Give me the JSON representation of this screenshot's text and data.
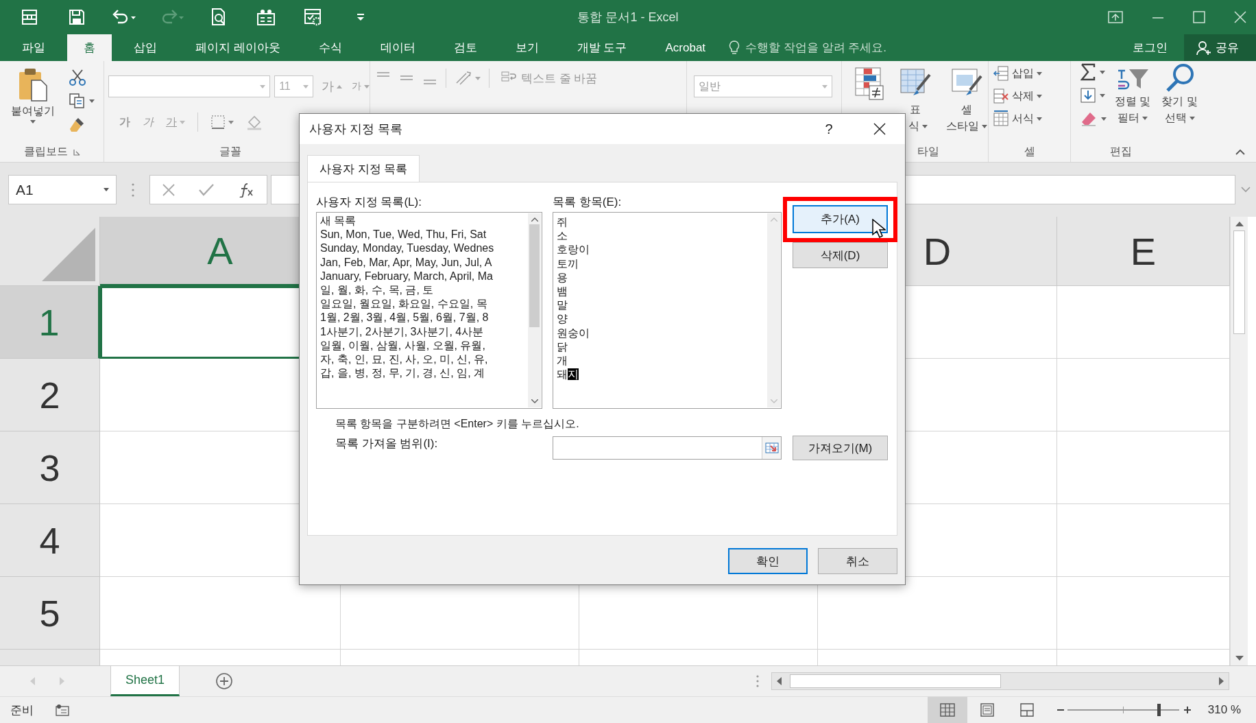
{
  "window": {
    "title": "통합 문서1 - Excel"
  },
  "quick_access": [
    {
      "kind": "form",
      "disabled": false
    },
    {
      "kind": "save",
      "disabled": false
    },
    {
      "kind": "undo",
      "disabled": false
    },
    {
      "kind": "redo",
      "disabled": true
    },
    {
      "kind": "preview",
      "disabled": false
    },
    {
      "kind": "board",
      "disabled": false
    },
    {
      "kind": "macro",
      "disabled": false
    },
    {
      "kind": "customize",
      "disabled": false
    }
  ],
  "ribbon_tabs": [
    {
      "label": "파일",
      "selected": false
    },
    {
      "label": "홈",
      "selected": true
    },
    {
      "label": "삽입",
      "selected": false
    },
    {
      "label": "페이지 레이아웃",
      "selected": false
    },
    {
      "label": "수식",
      "selected": false
    },
    {
      "label": "데이터",
      "selected": false
    },
    {
      "label": "검토",
      "selected": false
    },
    {
      "label": "보기",
      "selected": false
    },
    {
      "label": "개발 도구",
      "selected": false
    },
    {
      "label": "Acrobat",
      "selected": false
    }
  ],
  "tell_me": {
    "placeholder": "수행할 작업을 알려 주세요."
  },
  "account": {
    "sign_in": "로그인",
    "share": "공유"
  },
  "ribbon": {
    "clipboard": {
      "paste": "붙여넣기",
      "label": "클립보드"
    },
    "font": {
      "size": "11",
      "grow": "가",
      "shrink": "가",
      "bold": "가",
      "italic": "가",
      "underline": "가",
      "label": "글꼴"
    },
    "alignment": {
      "wrap_text": "텍스트 줄 바꿈"
    },
    "number": {
      "format": "일반"
    },
    "styles": {
      "table_format": [
        "표",
        "식"
      ],
      "cell_styles": [
        "셀",
        "스타일"
      ],
      "label": "타일"
    },
    "cells": {
      "buttons": [
        {
          "kind": "insert",
          "label": "삽입"
        },
        {
          "kind": "delete",
          "label": "삭제"
        },
        {
          "kind": "format",
          "label": "서식"
        }
      ],
      "label": "셀"
    },
    "editing": {
      "sort_filter": [
        "정렬 및",
        "필터"
      ],
      "find_select": [
        "찾기 및",
        "선택"
      ],
      "label": "편집"
    }
  },
  "name_box": {
    "value": "A1"
  },
  "sheet": {
    "columns": [
      {
        "label": "A",
        "selected": true
      },
      {
        "label": "D",
        "selected": false
      },
      {
        "label": "E",
        "selected": false
      }
    ],
    "rows": [
      {
        "label": "1",
        "selected": true
      },
      {
        "label": "2",
        "selected": false
      },
      {
        "label": "3",
        "selected": false
      },
      {
        "label": "4",
        "selected": false
      },
      {
        "label": "5",
        "selected": false
      }
    ]
  },
  "sheet_tabs": [
    {
      "label": "Sheet1",
      "selected": true
    }
  ],
  "status": {
    "text": "준비",
    "views": [
      {
        "kind": "normal",
        "selected": true
      },
      {
        "kind": "page-layout",
        "selected": false
      },
      {
        "kind": "page-break",
        "selected": false
      }
    ],
    "zoom_slider": {
      "level": 0.82
    },
    "zoom": "310 %"
  },
  "dialog": {
    "title": "사용자 지정 목록",
    "help": "?",
    "tabs": [
      {
        "label": "사용자 지정 목록",
        "selected": true
      }
    ],
    "lists_label": "사용자 지정 목록(L):",
    "lists": [
      {
        "text": "새 목록",
        "selected": false
      },
      {
        "text": "Sun, Mon, Tue, Wed, Thu, Fri, Sat",
        "selected": false
      },
      {
        "text": "Sunday, Monday, Tuesday, Wednes",
        "selected": false
      },
      {
        "text": "Jan, Feb, Mar, Apr, May, Jun, Jul, A",
        "selected": false
      },
      {
        "text": "January, February, March, April, Ma",
        "selected": false
      },
      {
        "text": "일, 월, 화, 수, 목, 금, 토",
        "selected": false
      },
      {
        "text": "일요일, 월요일, 화요일, 수요일, 목",
        "selected": false
      },
      {
        "text": "1월, 2월, 3월, 4월, 5월, 6월, 7월, 8",
        "selected": false
      },
      {
        "text": "1사분기, 2사분기, 3사분기, 4사분",
        "selected": false
      },
      {
        "text": "일월, 이월, 삼월, 사월, 오월, 유월,",
        "selected": false
      },
      {
        "text": "자, 축, 인, 묘, 진, 사, 오, 미, 신, 유,",
        "selected": false
      },
      {
        "text": "갑, 을, 병, 정, 무, 기, 경, 신, 임, 계",
        "selected": false
      }
    ],
    "entries_label": "목록 항목(E):",
    "entries": [
      {
        "text": "쥐"
      },
      {
        "text": "소"
      },
      {
        "text": "호랑이"
      },
      {
        "text": "토끼"
      },
      {
        "text": "용"
      },
      {
        "text": "뱀"
      },
      {
        "text": "말"
      },
      {
        "text": "양"
      },
      {
        "text": "원숭이"
      },
      {
        "text": "닭"
      },
      {
        "text": "개"
      },
      {
        "text": "돼",
        "selected_text": "지"
      }
    ],
    "add_button": {
      "label": "추가(A)",
      "focused": true,
      "highlighted": true
    },
    "delete_button": {
      "label": "삭제(D)"
    },
    "hint": "목록 항목을 구분하려면 <Enter> 키를 누르십시오.",
    "import_label": "목록 가져올 범위(I):",
    "import_button": {
      "label": "가져오기(M)"
    },
    "ok_button": {
      "label": "확인",
      "default": true
    },
    "cancel_button": {
      "label": "취소"
    }
  }
}
